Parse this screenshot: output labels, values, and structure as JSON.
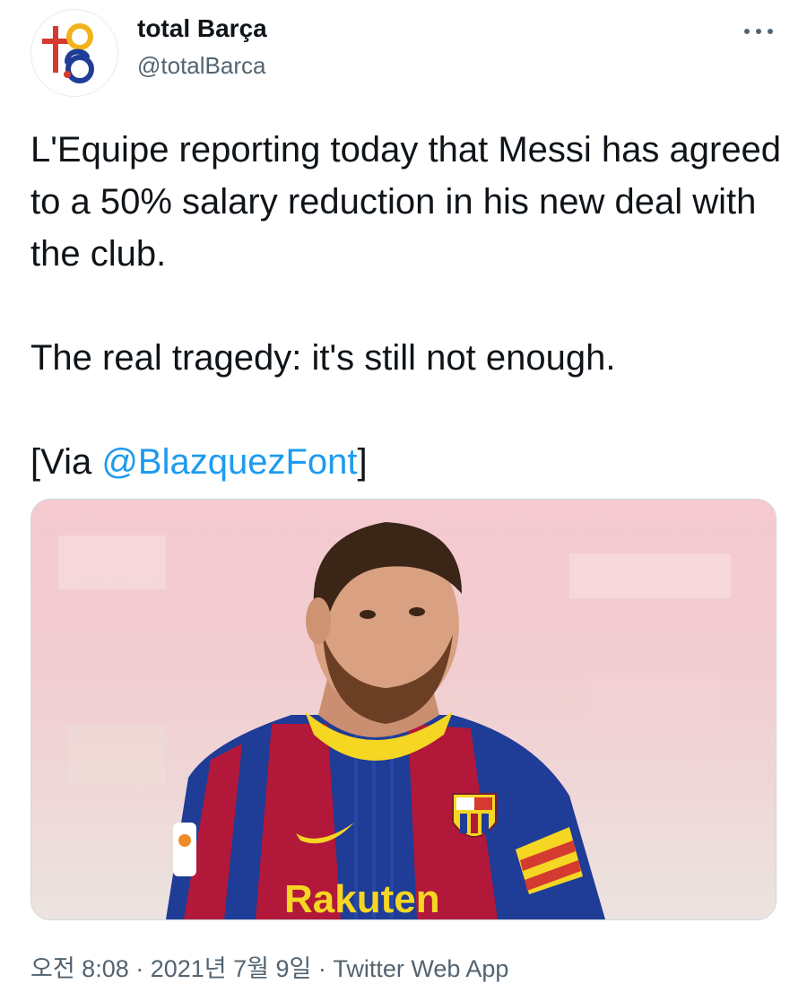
{
  "account": {
    "name": "total Barça",
    "handle": "@totalBarca"
  },
  "tweet": {
    "line1": "L'Equipe reporting today that Messi has agreed to a 50% salary reduction in his new deal with the club.",
    "line2": "The real tragedy: it's still not enough.",
    "via_prefix": "[Via ",
    "via_mention": "@BlazquezFont",
    "via_suffix": "]"
  },
  "media": {
    "sponsor_text": "Rakuten"
  },
  "meta": {
    "time": "오전 8:08",
    "sep1": " · ",
    "date": "2021년 7월 9일",
    "sep2": " · ",
    "app": "Twitter Web App"
  },
  "colors": {
    "link": "#1d9bf0",
    "secondary_text": "#536471",
    "barca_blue": "#1f3c96",
    "barca_red": "#b2183a",
    "gold": "#f5d623"
  }
}
